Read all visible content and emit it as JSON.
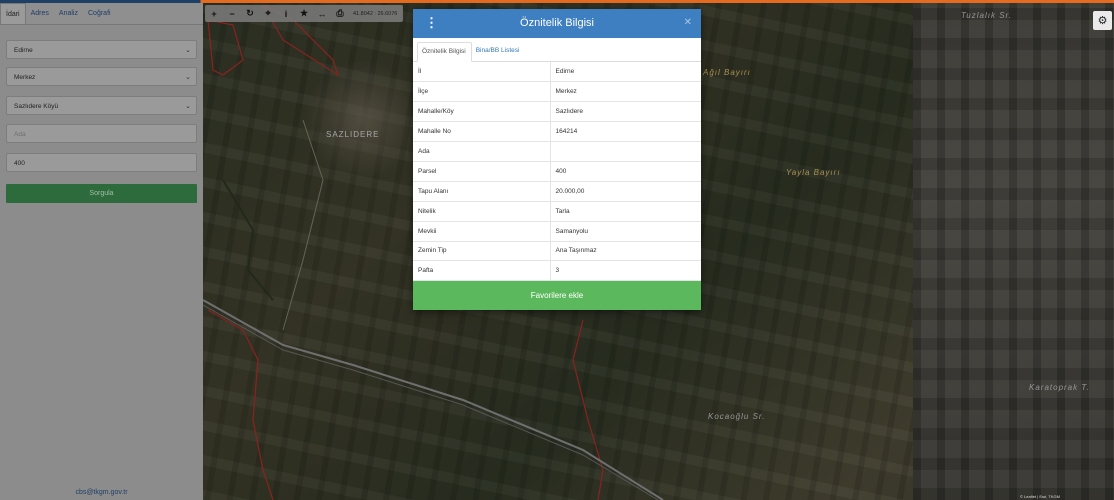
{
  "colors": {
    "header_blue": "#3e7fc1",
    "favorites_green": "#5cb85c",
    "query_green": "#2e6b3c",
    "accent_orange": "#e46b1f",
    "link_blue": "#337ab7"
  },
  "sidebar": {
    "tabs": [
      {
        "label": "İdari"
      },
      {
        "label": "Adres"
      },
      {
        "label": "Analiz"
      },
      {
        "label": "Coğrafi"
      }
    ],
    "province_select": "Edirne",
    "district_select": "Merkez",
    "village_select": "Sazlıdere Köyü",
    "ada_placeholder": "Ada",
    "parsel_value": "400",
    "query_button": "Sorgula",
    "footer_email": "cbs@tkgm.gov.tr"
  },
  "toolbar": {
    "icons": [
      "plus-icon",
      "minus-icon",
      "refresh-icon",
      "crosshair-icon",
      "info-icon",
      "star-icon",
      "measure-icon",
      "print-icon"
    ],
    "coordinates": "41.8042 : 26.6076"
  },
  "map": {
    "labels": [
      {
        "text": "SAZLIDERE"
      },
      {
        "text": "Ağıl Bayırı"
      },
      {
        "text": "Yayla Bayırı"
      },
      {
        "text": "Tuzlalık Sr."
      },
      {
        "text": "Kocaoğlu Sr."
      },
      {
        "text": "Karatoprak T."
      }
    ],
    "attribution": "© Leaflet | Esri, TKGM"
  },
  "modal": {
    "title": "Öznitelik Bilgisi",
    "tabs": [
      {
        "label": "Öznitelik Bilgisi",
        "active": true
      },
      {
        "label": "Bina/BB Listesi",
        "active": false
      }
    ],
    "rows": [
      {
        "key": "İl",
        "value": "Edirne"
      },
      {
        "key": "İlçe",
        "value": "Merkez"
      },
      {
        "key": "Mahalle/Köy",
        "value": "Sazlıdere"
      },
      {
        "key": "Mahalle No",
        "value": "164214"
      },
      {
        "key": "Ada",
        "value": ""
      },
      {
        "key": "Parsel",
        "value": "400"
      },
      {
        "key": "Tapu Alanı",
        "value": "20.000,00"
      },
      {
        "key": "Nitelik",
        "value": "Tarla"
      },
      {
        "key": "Mevkii",
        "value": "Samanyolu"
      },
      {
        "key": "Zemin Tip",
        "value": "Ana Taşınmaz"
      },
      {
        "key": "Pafta",
        "value": "3"
      }
    ],
    "favorites_button": "Favorilere ekle"
  }
}
